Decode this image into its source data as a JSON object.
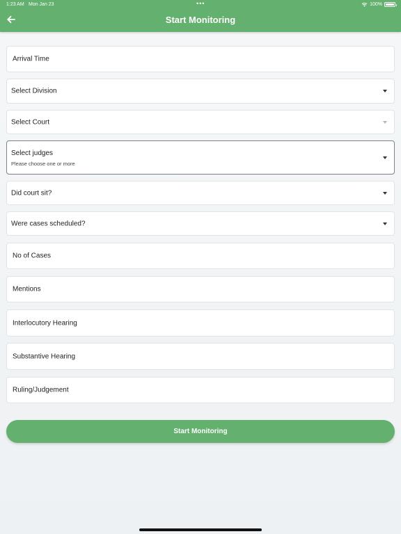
{
  "status_bar": {
    "time": "1:23 AM",
    "date": "Mon Jan 23",
    "dots": "•••",
    "battery": "100%"
  },
  "header": {
    "title": "Start Monitoring",
    "back_icon": "arrow-left-icon"
  },
  "form": {
    "arrival_time": "Arrival Time",
    "division": "Select Division",
    "court": "Select Court",
    "judges": {
      "label": "Select judges",
      "hint": "Please choose one or more"
    },
    "court_sat": "Did court sit?",
    "cases_scheduled": "Were cases scheduled?",
    "no_of_cases": "No of Cases",
    "mentions": "Mentions",
    "interlocutory": "Interlocutory Hearing",
    "substantive": "Substantive Hearing",
    "ruling": "Ruling/Judgement"
  },
  "actions": {
    "start_label": "Start Monitoring"
  },
  "colors": {
    "accent": "#64b06e"
  }
}
